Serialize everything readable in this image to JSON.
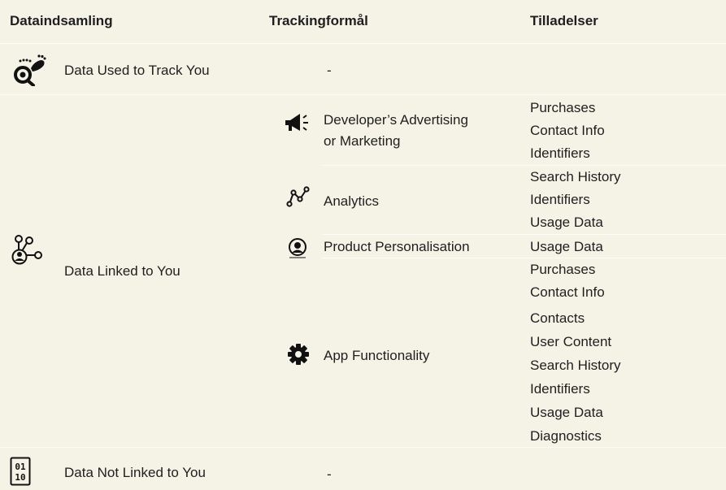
{
  "headers": {
    "collection": "Dataindsamling",
    "purpose": "Trackingformål",
    "permissions": "Tilladelser"
  },
  "rows": {
    "track": {
      "icon": "footprint-search-icon",
      "label": "Data Used to Track You",
      "purpose": "-"
    },
    "linked": {
      "icon": "person-network-icon",
      "label": "Data Linked to You",
      "purposes": [
        {
          "icon": "megaphone-icon",
          "label_line1": "Developer’s Advertising",
          "label_line2": "or Marketing",
          "permissions": [
            "Purchases",
            "Contact Info",
            "Identifiers"
          ]
        },
        {
          "icon": "analytics-graph-icon",
          "label": "Analytics",
          "permissions": [
            "Search History",
            "Identifiers",
            "Usage Data"
          ]
        },
        {
          "icon": "person-circle-icon",
          "label": "Product Personalisation",
          "permissions": [
            "Usage Data"
          ]
        },
        {
          "icon": "gear-icon",
          "label": "App Functionality",
          "permissions": [
            "Purchases",
            "Contact Info",
            "Contacts",
            "User Content",
            "Search History",
            "Identifiers",
            "Usage Data",
            "Diagnostics"
          ]
        }
      ]
    },
    "not_linked": {
      "icon": "binary-data-icon",
      "label": "Data Not Linked to You",
      "purpose": "-"
    }
  }
}
